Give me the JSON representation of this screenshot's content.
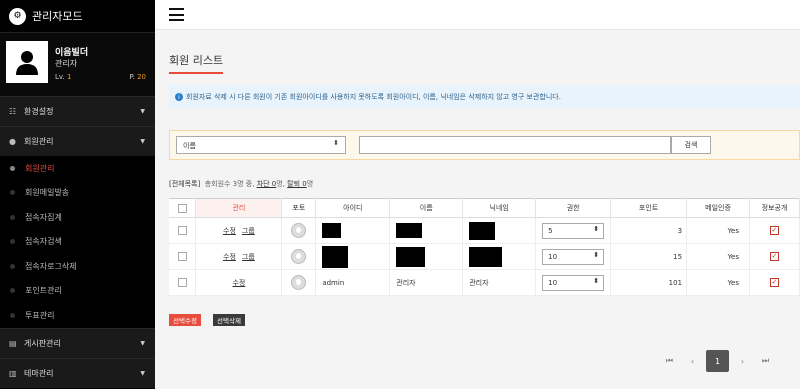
{
  "app": {
    "title": "관리자모드",
    "logo_icon": "gear-icon"
  },
  "profile": {
    "name": "이음빌더",
    "role": "관리자",
    "level_label": "Lv.",
    "level": "1",
    "point_label": "P.",
    "point": "20"
  },
  "sidebar": {
    "groups": [
      {
        "label": "환경설정",
        "icon": "sliders-icon"
      },
      {
        "label": "회원관리",
        "icon": "user-icon"
      },
      {
        "label": "게시판관리",
        "icon": "board-icon"
      },
      {
        "label": "테마관리",
        "icon": "theme-icon"
      }
    ],
    "sub_items": [
      "회원관리",
      "회원메일발송",
      "접속자집계",
      "접속자검색",
      "접속자로그삭제",
      "포인트관리",
      "투표관리"
    ]
  },
  "page": {
    "title": "회원 리스트",
    "notice": "회원자료 삭제 시 다른 회원이 기존 회원아이디를 사용하지 못하도록 회원아이디, 이름, 닉네임은 삭제하지 않고 영구 보관합니다."
  },
  "search": {
    "field_value": "이름",
    "input_value": "",
    "button": "검색"
  },
  "summary": {
    "all": "[전체목록]",
    "total_pre": "총회원수 3명 중,",
    "blocked": "차단 0",
    "blocked_unit": "명,",
    "left": "탈퇴 0",
    "left_unit": "명"
  },
  "table": {
    "headers": [
      "관리",
      "포토",
      "아이디",
      "이름",
      "닉네임",
      "권한",
      "포인트",
      "메일인증",
      "정보공개"
    ],
    "rows": [
      {
        "edit": "수정",
        "group": "그룹",
        "id": "",
        "name": "",
        "nick": "",
        "level": "5",
        "point": "3",
        "mail": "Yes"
      },
      {
        "edit": "수정",
        "group": "그룹",
        "id": "",
        "name": "",
        "nick": "",
        "level": "10",
        "point": "15",
        "mail": "Yes"
      },
      {
        "edit": "수정",
        "group": "",
        "id": "admin",
        "name": "관리자",
        "nick": "관리자",
        "level": "10",
        "point": "101",
        "mail": "Yes"
      }
    ]
  },
  "actions": {
    "edit_selected": "선택수정",
    "delete_selected": "선택삭제"
  },
  "pagination": {
    "current": "1"
  },
  "colors": {
    "accent": "#e74c3c",
    "sidebar_bg": "#000000",
    "notice_bg": "#e8f3fb"
  }
}
